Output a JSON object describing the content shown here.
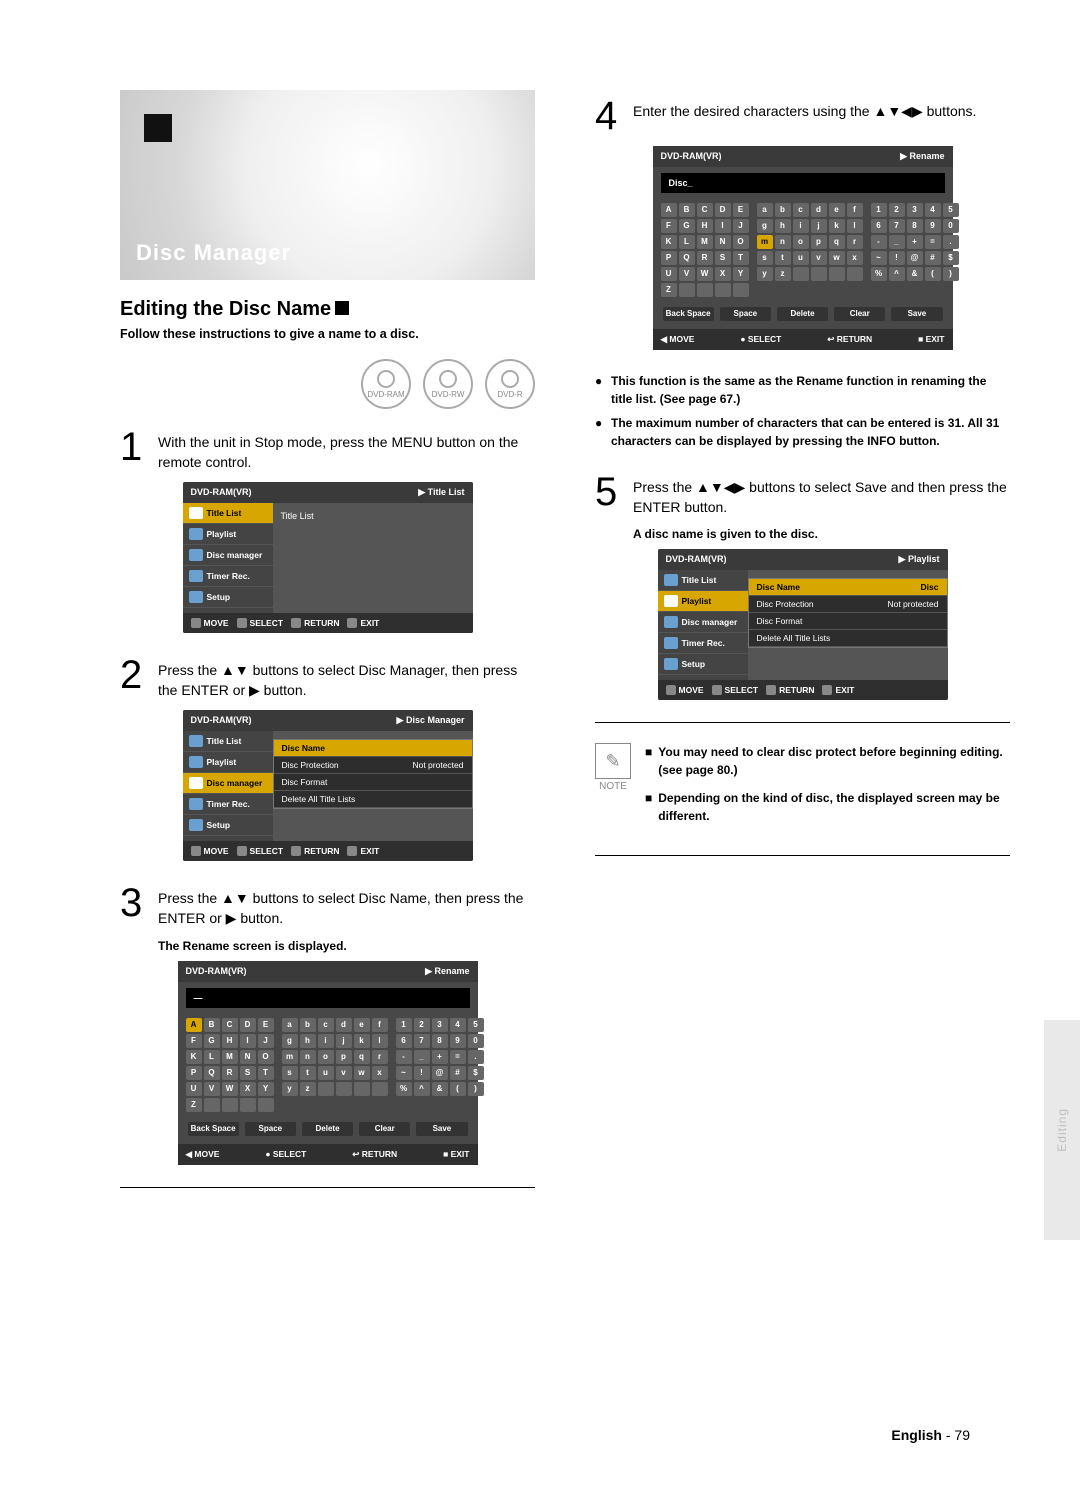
{
  "side_tab": "Editing",
  "hero_title": "Disc Manager",
  "section_heading": "Editing the Disc Name",
  "lead": "Follow these instructions to give a name to a disc.",
  "badges": [
    "DVD-RAM",
    "DVD-RW",
    "DVD-R"
  ],
  "steps": {
    "s1": {
      "num": "1",
      "txt": "With the unit in Stop mode, press the MENU button on the remote control."
    },
    "s2": {
      "num": "2",
      "txt": "Press the ▲▼ buttons to select Disc Manager, then press the ENTER or ▶ button."
    },
    "s3": {
      "num": "3",
      "txt": "Press the ▲▼ buttons to select Disc Name, then press the ENTER or ▶ button."
    },
    "s3_sub": "The Rename screen is displayed.",
    "s4": {
      "num": "4",
      "txt": "Enter the desired characters using the ▲▼◀▶ buttons."
    },
    "s5": {
      "num": "5",
      "txt": "Press the ▲▼◀▶ buttons to select Save and then press the ENTER button."
    },
    "s5_sub": "A disc name is given to the disc."
  },
  "osd": {
    "header_left": "DVD-RAM(VR)",
    "menu": [
      {
        "label": "Title List",
        "icon": "title-list-icon"
      },
      {
        "label": "Playlist",
        "icon": "playlist-icon"
      },
      {
        "label": "Disc manager",
        "icon": "disc-manager-icon"
      },
      {
        "label": "Timer Rec.",
        "icon": "timer-rec-icon"
      },
      {
        "label": "Setup",
        "icon": "setup-icon"
      }
    ],
    "screen1": {
      "header_right": "Title List",
      "main": "Title List"
    },
    "screen2": {
      "header_right": "Disc Manager",
      "rows": [
        {
          "l": "Disc Name",
          "r": "",
          "sel": true
        },
        {
          "l": "Disc Protection",
          "r": "Not protected"
        },
        {
          "l": "Disc Format",
          "r": ""
        },
        {
          "l": "Delete All Title Lists",
          "r": ""
        }
      ]
    },
    "screen5": {
      "header_right": "Playlist",
      "rows": [
        {
          "l": "Disc Name",
          "r": "Disc",
          "sel": true
        },
        {
          "l": "Disc Protection",
          "r": "Not protected"
        },
        {
          "l": "Disc Format",
          "r": ""
        },
        {
          "l": "Delete All Title Lists",
          "r": ""
        }
      ]
    },
    "foot": [
      {
        "k": "MOVE"
      },
      {
        "k": "SELECT"
      },
      {
        "k": "RETURN"
      },
      {
        "k": "EXIT"
      }
    ]
  },
  "kbd": {
    "header_right": "Rename",
    "field3": "—",
    "field4": "Disc_",
    "bar": [
      "Back Space",
      "Space",
      "Delete",
      "Clear",
      "Save"
    ],
    "foot": [
      "MOVE",
      "SELECT",
      "RETURN",
      "EXIT"
    ],
    "left_rows": [
      [
        "A",
        "B",
        "C",
        "D",
        "E"
      ],
      [
        "F",
        "G",
        "H",
        "I",
        "J"
      ],
      [
        "K",
        "L",
        "M",
        "N",
        "O"
      ],
      [
        "P",
        "Q",
        "R",
        "S",
        "T"
      ],
      [
        "U",
        "V",
        "W",
        "X",
        "Y"
      ],
      [
        "Z",
        "",
        "",
        "",
        ""
      ]
    ],
    "mid_rows": [
      [
        "a",
        "b",
        "c",
        "d",
        "e",
        "f"
      ],
      [
        "g",
        "h",
        "i",
        "j",
        "k",
        "l"
      ],
      [
        "m",
        "n",
        "o",
        "p",
        "q",
        "r"
      ],
      [
        "s",
        "t",
        "u",
        "v",
        "w",
        "x"
      ],
      [
        "y",
        "z",
        "",
        "",
        "",
        ""
      ]
    ],
    "right_rows": [
      [
        "1",
        "2",
        "3",
        "4",
        "5"
      ],
      [
        "6",
        "7",
        "8",
        "9",
        "0"
      ],
      [
        "-",
        "_",
        "+",
        "=",
        "."
      ],
      [
        "~",
        "!",
        "@",
        "#",
        "$"
      ],
      [
        "%",
        "^",
        "&",
        "(",
        ")"
      ]
    ]
  },
  "info_bullets": [
    "This function is the same as the Rename function in renaming the title list. (See page 67.)",
    "The maximum number of characters that can be entered is 31. All 31 characters can be displayed by pressing the INFO button."
  ],
  "note_label": "NOTE",
  "note_items": [
    "You may need to clear disc protect before beginning editing.(see page 80.)",
    "Depending on the kind of disc, the displayed screen may be different."
  ],
  "footer": {
    "lang": "English",
    "sep": " - ",
    "page": "79"
  }
}
